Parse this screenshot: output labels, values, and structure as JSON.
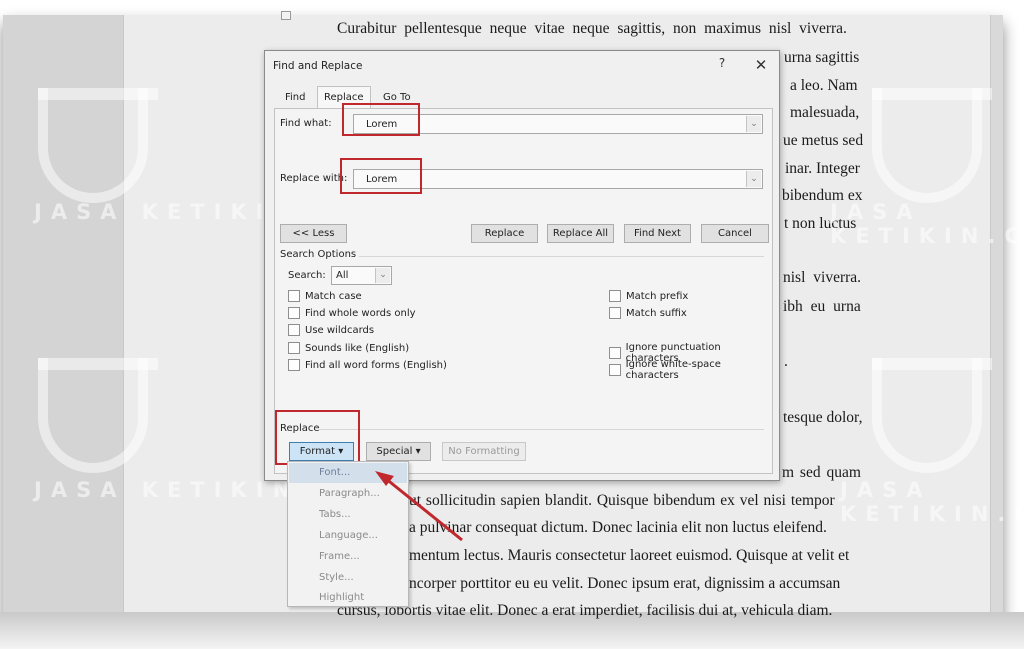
{
  "document": {
    "lines": [
      "Curabitur pellentesque neque vitae neque sagittis, non maximus nisl viverra.",
      "urna sagittis",
      "a leo. Nam",
      "malesuada,",
      "ue metus sed",
      "inar. Integer",
      "bibendum ex",
      "t non luctus",
      "nisl viverra.",
      "ibh eu urna",
      ".",
      "tesque dolor,",
      "m sed quam",
      "ut sollicitudin sapien blandit. Quisque bibendum ex vel nisi tempor",
      "a pulvinar consequat dictum. Donec lacinia elit non luctus eleifend.",
      "mentum lectus. Mauris consectetur laoreet euismod. Quisque at velit et",
      "ncorper porttitor eu eu velit. Donec ipsum erat, dignissim a accumsan",
      "cursus, lobortis vitae elit. Donec a erat imperdiet, facilisis dui at, vehicula diam."
    ],
    "watermark": "JASA KETIKIN.COM"
  },
  "dialog": {
    "title": "Find and Replace",
    "help_label": "?",
    "close_label": "✕",
    "tabs": [
      {
        "label": "Find",
        "active": false
      },
      {
        "label": "Replace",
        "active": true
      },
      {
        "label": "Go To",
        "active": false
      }
    ],
    "find_what": {
      "label": "Find what:",
      "value": "Lorem"
    },
    "replace_with": {
      "label": "Replace with:",
      "value": "Lorem"
    },
    "buttons": {
      "less": "<< Less",
      "replace": "Replace",
      "replace_all": "Replace All",
      "find_next": "Find Next",
      "cancel": "Cancel"
    },
    "search_options": {
      "title": "Search Options",
      "search_label": "Search:",
      "search_value": "All",
      "left_checks": [
        {
          "label": "Match case",
          "checked": false
        },
        {
          "label": "Find whole words only",
          "checked": false
        },
        {
          "label": "Use wildcards",
          "checked": false
        },
        {
          "label": "Sounds like (English)",
          "checked": false
        },
        {
          "label": "Find all word forms (English)",
          "checked": false
        }
      ],
      "right_checks": [
        {
          "label": "Match prefix",
          "checked": false
        },
        {
          "label": "Match suffix",
          "checked": false
        },
        {
          "label": "Ignore punctuation characters",
          "checked": false
        },
        {
          "label": "Ignore white-space characters",
          "checked": false
        }
      ]
    },
    "replace_section": {
      "title": "Replace",
      "format_button": "Format ▾",
      "special_button": "Special ▾",
      "no_formatting_button": "No Formatting"
    }
  },
  "format_menu": {
    "items": [
      "Font...",
      "Paragraph...",
      "Tabs...",
      "Language...",
      "Frame...",
      "Style...",
      "Highlight"
    ],
    "hovered": "Font..."
  },
  "annotation": {
    "highlight_color": "#c0282e",
    "arrow_color": "#c0282e"
  },
  "icons": {
    "combo_arrow": "chevron-down-icon",
    "close": "close-icon",
    "help": "help-icon"
  }
}
